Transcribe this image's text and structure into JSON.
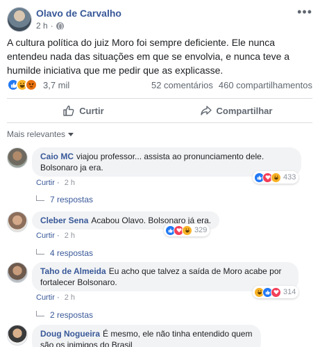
{
  "post": {
    "author": "Olavo de Carvalho",
    "time": "2 h",
    "separator": "·",
    "text": "A cultura política do juiz Moro foi sempre deficiente. Ele nunca entendeu nada das situações em que se envolvia, e nunca teve a humilde iniciativa que me pedir que as explicasse.",
    "reaction_icons": [
      "like-icon",
      "haha-icon",
      "angry-icon"
    ],
    "reaction_count": "3,7 mil",
    "comments_count": "52 comentários",
    "shares_count": "460 compartilhamentos"
  },
  "actions": {
    "like_label": "Curtir",
    "share_label": "Compartilhar"
  },
  "sort": {
    "label": "Mais relevantes"
  },
  "comments": [
    {
      "name": "Caio MC",
      "text": "viajou professor... assista ao pronunciamento dele. Bolsonaro ja era.",
      "like_label": "Curtir",
      "time": "2 h",
      "reaction_icons": [
        "like-icon",
        "love-icon",
        "haha-icon"
      ],
      "reaction_count": "433",
      "replies": "7 respostas"
    },
    {
      "name": "Cleber Sena",
      "text": "Acabou Olavo. Bolsonaro já era.",
      "like_label": "Curtir",
      "time": "2 h",
      "reaction_icons": [
        "like-icon",
        "love-icon",
        "haha-icon"
      ],
      "reaction_count": "329",
      "replies": "4 respostas"
    },
    {
      "name": "Taho de Almeida",
      "text": "Eu acho que talvez a saída de Moro acabe por fortalecer Bolsonaro.",
      "like_label": "Curtir",
      "time": "2 h",
      "reaction_icons": [
        "haha-icon",
        "like-icon",
        "love-icon"
      ],
      "reaction_count": "314",
      "replies": "2 respostas"
    },
    {
      "name": "Doug Nogueira",
      "text": "É mesmo, ele não tinha entendido quem são os inimigos do Brasil"
    }
  ],
  "colors": {
    "link": "#385898",
    "like": "#2078f4",
    "love": "#f33e58",
    "haha": "#f7b125",
    "angry": "#e9710f",
    "bubble": "#f2f3f5"
  }
}
